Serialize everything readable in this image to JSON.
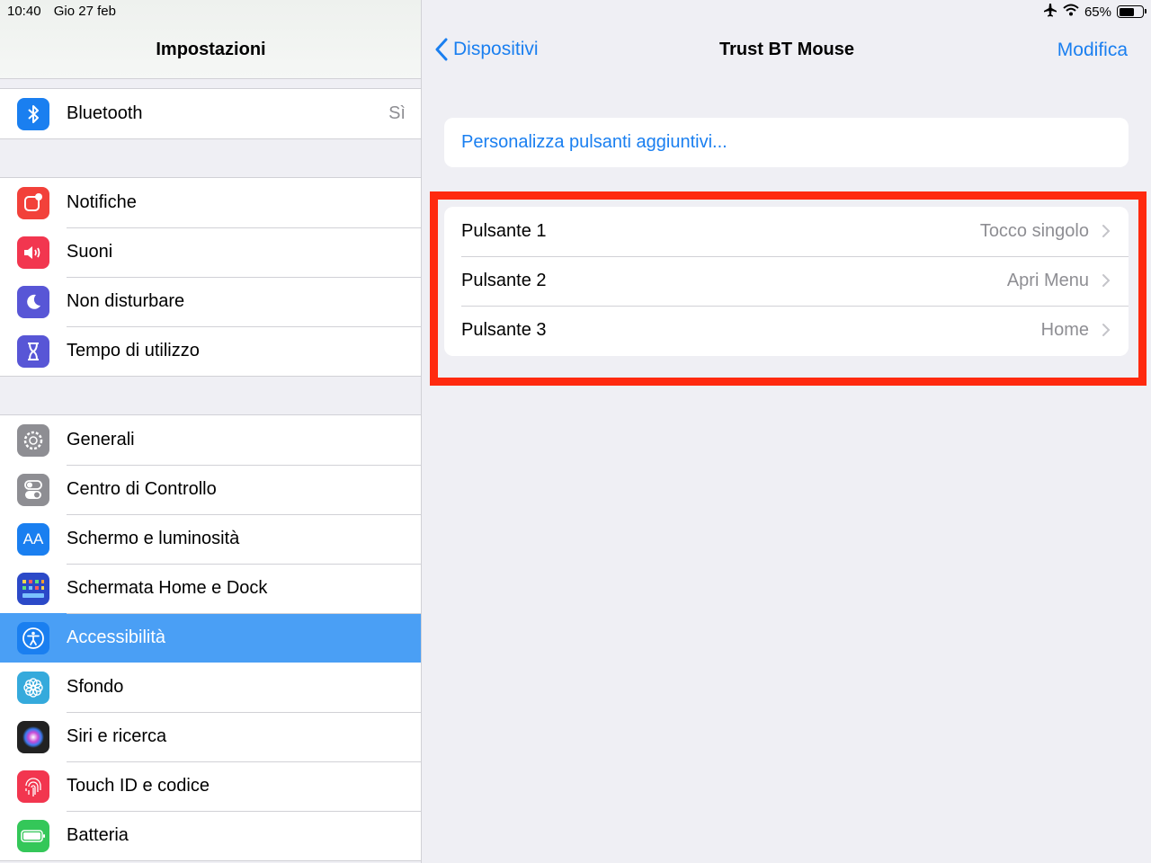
{
  "status": {
    "time": "10:40",
    "date": "Gio 27 feb",
    "battery": "65%",
    "battery_level": 0.65
  },
  "sidebar": {
    "title": "Impostazioni",
    "group1": [
      {
        "label": "Bluetooth",
        "value": "Sì",
        "icon": "bluetooth-icon",
        "color": "#1a7ff0"
      }
    ],
    "group2": [
      {
        "label": "Notifiche",
        "icon": "notifications-icon",
        "color": "#f2413a"
      },
      {
        "label": "Suoni",
        "icon": "sounds-icon",
        "color": "#f2364f"
      },
      {
        "label": "Non disturbare",
        "icon": "moon-icon",
        "color": "#5856d6"
      },
      {
        "label": "Tempo di utilizzo",
        "icon": "hourglass-icon",
        "color": "#5856d6"
      }
    ],
    "group3": [
      {
        "label": "Generali",
        "icon": "gear-icon",
        "color": "#8e8e93"
      },
      {
        "label": "Centro di Controllo",
        "icon": "toggles-icon",
        "color": "#8e8e93"
      },
      {
        "label": "Schermo e luminosità",
        "icon": "text-size-icon",
        "color": "#1a7ff0"
      },
      {
        "label": "Schermata Home e Dock",
        "icon": "home-grid-icon",
        "color": "#2b49c8"
      },
      {
        "label": "Accessibilità",
        "icon": "accessibility-icon",
        "color": "#1a7ff0",
        "selected": true
      },
      {
        "label": "Sfondo",
        "icon": "flower-icon",
        "color": "#35aadc"
      },
      {
        "label": "Siri e ricerca",
        "icon": "siri-icon",
        "color": "#222222"
      },
      {
        "label": "Touch ID e codice",
        "icon": "fingerprint-icon",
        "color": "#f2364f"
      },
      {
        "label": "Batteria",
        "icon": "battery-icon",
        "color": "#34c759"
      }
    ]
  },
  "detail": {
    "back_label": "Dispositivi",
    "title": "Trust BT Mouse",
    "edit_label": "Modifica",
    "customize_label": "Personalizza pulsanti aggiuntivi...",
    "buttons": [
      {
        "label": "Pulsante 1",
        "value": "Tocco singolo"
      },
      {
        "label": "Pulsante 2",
        "value": "Apri Menu"
      },
      {
        "label": "Pulsante 3",
        "value": "Home"
      }
    ]
  }
}
